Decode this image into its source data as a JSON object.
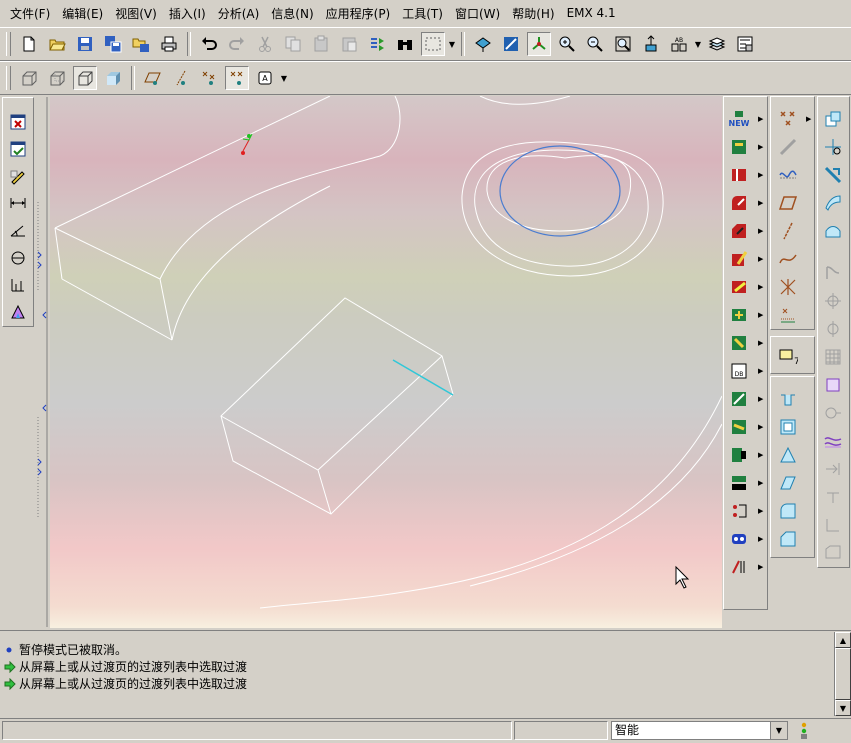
{
  "menubar": {
    "items": [
      "文件(F)",
      "编辑(E)",
      "视图(V)",
      "插入(I)",
      "分析(A)",
      "信息(N)",
      "应用程序(P)",
      "工具(T)",
      "窗口(W)",
      "帮助(H)",
      "EMX 4.1"
    ]
  },
  "toolbar1": {
    "icons": [
      "new-file-icon",
      "open-folder-icon",
      "save-icon",
      "save-copy-icon",
      "backup-icon",
      "print-icon",
      "undo-icon",
      "redo-icon",
      "cut-icon",
      "copy-icon",
      "paste-icon",
      "paste-special-icon",
      "regenerate-icon",
      "search-binoculars-icon",
      "select-box-icon",
      "datum-display-icon",
      "sketch-view-icon",
      "spin-center-icon",
      "zoom-in-icon",
      "zoom-out-icon",
      "refit-icon",
      "orient-icon",
      "named-view-icon",
      "layers-icon",
      "model-tree-icon"
    ]
  },
  "toolbar2": {
    "icons": [
      "wireframe-icon",
      "hidden-line-icon",
      "no-hidden-icon",
      "shaded-icon",
      "datum-planes-toggle-icon",
      "datum-axes-toggle-icon",
      "datum-points-toggle-icon",
      "coord-sys-toggle-icon",
      "annotations-icon"
    ]
  },
  "status": {
    "messages": [
      {
        "type": "info",
        "text": "暂停模式已被取消。"
      },
      {
        "type": "prompt",
        "text": "从屏幕上或从过渡页的过渡列表中选取过渡"
      },
      {
        "type": "prompt",
        "text": "从屏幕上或从过渡页的过渡列表中选取过渡"
      }
    ]
  },
  "filter": {
    "value": "智能"
  },
  "colors": {
    "accent_blue": "#4a7cd0",
    "highlight_cyan": "#30c8d8",
    "model_line": "#ffffff"
  }
}
